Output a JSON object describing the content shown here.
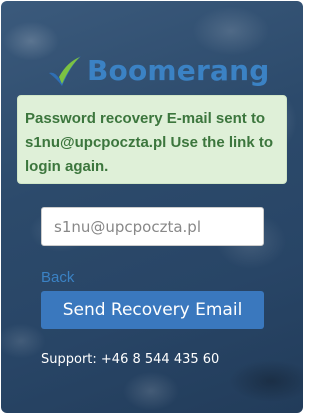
{
  "logo": {
    "text": "Boomerang",
    "icon": "boomerang-checkmark-icon",
    "colors": {
      "text": "#3b82c4",
      "mark_blue": "#2f6fb5",
      "mark_green": "#7cc242"
    }
  },
  "alert": {
    "message": "Password recovery E-mail sent to s1nu@upcpoczta.pl Use the link to login again.",
    "colors": {
      "background": "#dff0d8",
      "text": "#3c763d"
    }
  },
  "form": {
    "email_value": "s1nu@upcpoczta.pl",
    "back_label": "Back",
    "submit_label": "Send Recovery Email",
    "colors": {
      "button": "#3a78be",
      "link": "#3b82c4"
    }
  },
  "support": {
    "text": "Support: +46 8 544 435 60"
  }
}
